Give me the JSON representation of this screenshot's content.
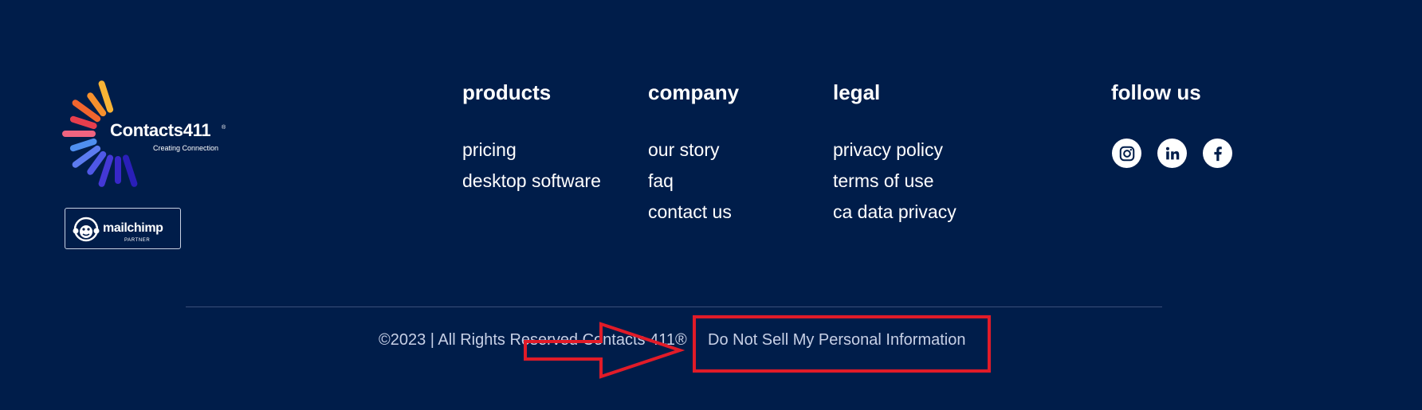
{
  "brand": {
    "name": "Contacts411",
    "registered_mark": "®",
    "tagline": "Creating Connection",
    "logo_icon": "sunburst-icon",
    "ray_colors": [
      "#f8b335",
      "#f6902d",
      "#f1652e",
      "#e73e4d",
      "#f06480",
      "#4f8ff0",
      "#5c7bf0",
      "#4f58e6",
      "#4438d6",
      "#3727c8",
      "#2a1fb8"
    ]
  },
  "partner_badge": {
    "name": "mailchimp",
    "label": "PARTNER",
    "icon": "freddie-monkey-icon"
  },
  "nav": {
    "products": {
      "heading": "products",
      "links": [
        "pricing",
        "desktop software"
      ]
    },
    "company": {
      "heading": "company",
      "links": [
        "our story",
        "faq",
        "contact us"
      ]
    },
    "legal": {
      "heading": "legal",
      "links": [
        "privacy policy",
        "terms of use",
        "ca data privacy"
      ]
    },
    "follow": {
      "heading": "follow us",
      "icons": [
        "instagram-icon",
        "linkedin-icon",
        "facebook-icon"
      ]
    }
  },
  "footer": {
    "copyright": "©2023 | All Rights Reserved Contacts 411®",
    "dns_link": "Do Not Sell My Personal Information"
  },
  "colors": {
    "background": "#001d4a",
    "text": "#ffffff",
    "muted_text": "#c7d0e6",
    "divider": "#3b4f79",
    "annotation": "#e11b28"
  }
}
